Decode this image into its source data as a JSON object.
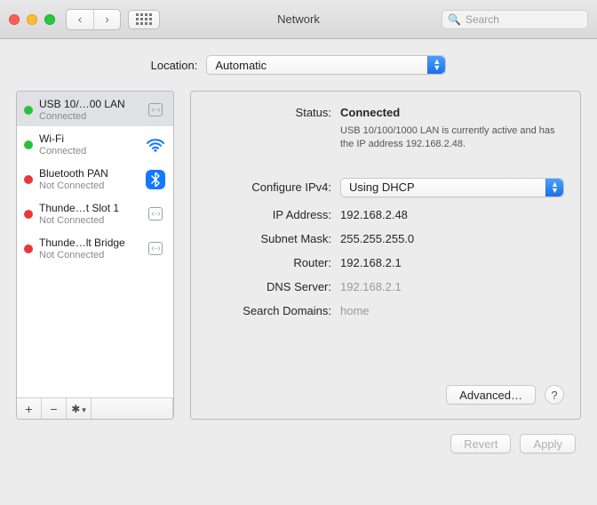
{
  "title": "Network",
  "search": {
    "placeholder": "Search"
  },
  "location": {
    "label": "Location:",
    "value": "Automatic"
  },
  "sidebar": {
    "items": [
      {
        "name": "USB 10/…00 LAN",
        "status": "Connected",
        "dot": "green",
        "icon": "eth"
      },
      {
        "name": "Wi-Fi",
        "status": "Connected",
        "dot": "green",
        "icon": "wifi"
      },
      {
        "name": "Bluetooth PAN",
        "status": "Not Connected",
        "dot": "red",
        "icon": "bt"
      },
      {
        "name": "Thunde…t Slot  1",
        "status": "Not Connected",
        "dot": "red",
        "icon": "eth"
      },
      {
        "name": "Thunde…lt Bridge",
        "status": "Not Connected",
        "dot": "red",
        "icon": "eth"
      }
    ]
  },
  "panel": {
    "status_label": "Status:",
    "status_value": "Connected",
    "status_desc": "USB 10/100/1000 LAN is currently active and has the IP address 192.168.2.48.",
    "configure_label": "Configure IPv4:",
    "configure_value": "Using DHCP",
    "ip_label": "IP Address:",
    "ip_value": "192.168.2.48",
    "subnet_label": "Subnet Mask:",
    "subnet_value": "255.255.255.0",
    "router_label": "Router:",
    "router_value": "192.168.2.1",
    "dns_label": "DNS Server:",
    "dns_value": "192.168.2.1",
    "search_label": "Search Domains:",
    "search_value": "home",
    "advanced": "Advanced…"
  },
  "bottom": {
    "revert": "Revert",
    "apply": "Apply"
  }
}
